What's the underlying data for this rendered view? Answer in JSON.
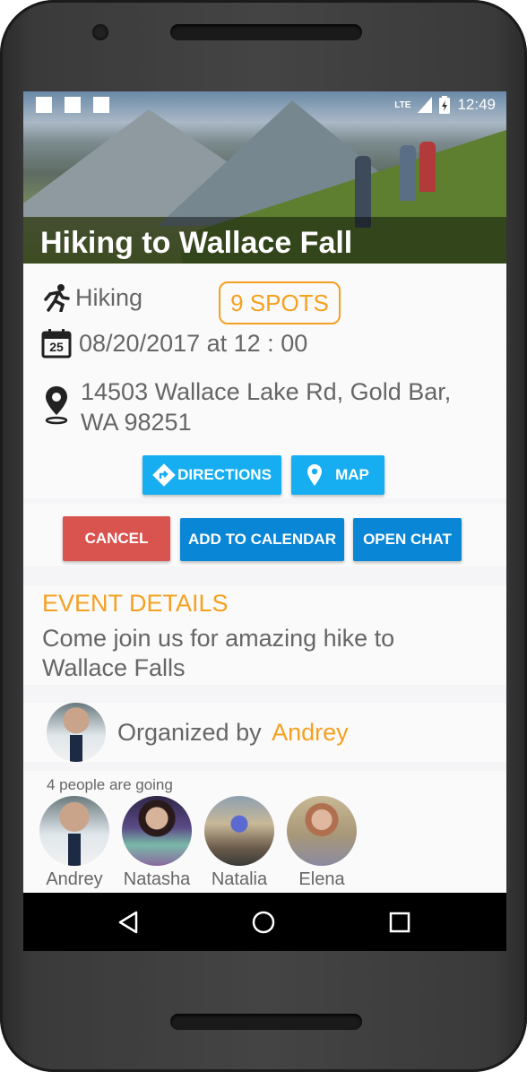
{
  "status": {
    "network": "LTE",
    "time": "12:49"
  },
  "event": {
    "title": "Hiking to Wallace Fall",
    "activity": "Hiking",
    "spots_label": "9 SPOTS",
    "calendar_day": "25",
    "datetime": "08/20/2017 at 12 : 00",
    "address_line1": "14503 Wallace Lake Rd, Gold Bar,",
    "address_line2": "WA 98251"
  },
  "buttons": {
    "directions": "DIRECTIONS",
    "map": "MAP",
    "cancel": "CANCEL",
    "add_to_calendar": "ADD TO CALENDAR",
    "open_chat": "OPEN CHAT"
  },
  "details": {
    "heading": "EVENT DETAILS",
    "line1": "Come join us for amazing hike to",
    "line2": "Wallace Falls"
  },
  "organizer": {
    "prefix": "Organized by",
    "name": "Andrey"
  },
  "attendees": {
    "count_label": "4 people are going",
    "people": [
      "Andrey",
      "Natasha",
      "Natalia",
      "Elena"
    ]
  },
  "colors": {
    "accent_orange": "#f6a020",
    "button_blue": "#0a86d6",
    "button_light_blue": "#16aef0",
    "button_red": "#d9534f"
  },
  "icons": {
    "activity": "running-person-icon",
    "date": "calendar-icon",
    "location": "map-pin-icon",
    "directions": "directions-icon",
    "map": "map-pin-icon",
    "nav_back": "back-triangle-icon",
    "nav_home": "home-circle-icon",
    "nav_recents": "recents-square-icon"
  }
}
